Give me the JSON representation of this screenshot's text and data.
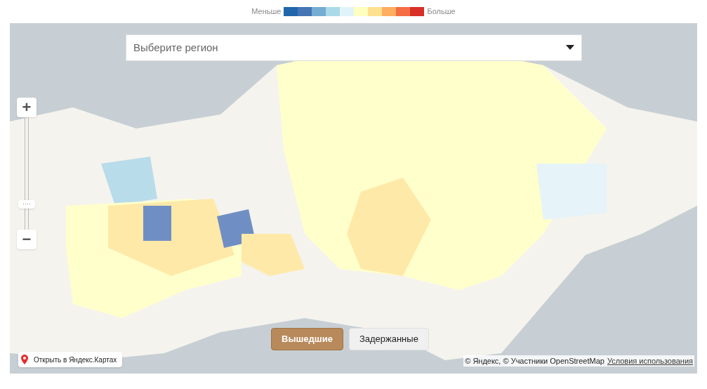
{
  "legend": {
    "low_label": "Меньше",
    "high_label": "Больше",
    "swatches": [
      {
        "color": "#2166ac"
      },
      {
        "color": "#4575b4"
      },
      {
        "color": "#74add1"
      },
      {
        "color": "#abd9e9"
      },
      {
        "color": "#e0f3f8"
      },
      {
        "color": "#ffffbf"
      },
      {
        "color": "#fee090"
      },
      {
        "color": "#fdae61"
      },
      {
        "color": "#f46d43"
      },
      {
        "color": "#d73027"
      }
    ]
  },
  "region_select": {
    "placeholder": "Выберите регион"
  },
  "zoom": {
    "plus": "+",
    "minus": "−",
    "level": 0.2
  },
  "toggle": [
    {
      "label": "Вышедшие",
      "selected": true
    },
    {
      "label": "Задержанные",
      "selected": false
    }
  ],
  "open_link": "Открыть в Яндекс.Картах",
  "attribution": {
    "text": "© Яндекс, © Участники OpenStreetMap",
    "terms": "Условия использования"
  }
}
